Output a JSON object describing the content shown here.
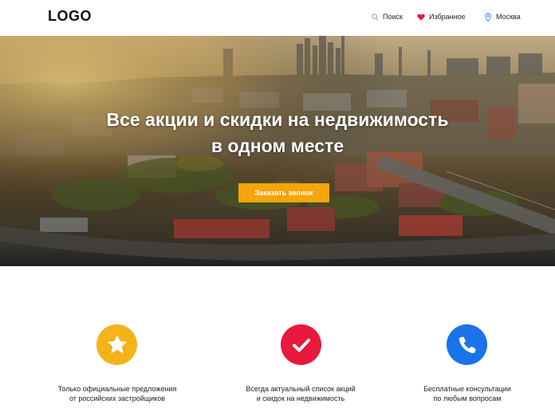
{
  "header": {
    "logo": "LOGO",
    "nav": {
      "search": {
        "label": "Поиск",
        "icon": "search-icon"
      },
      "favorites": {
        "label": "Избранное",
        "icon": "heart-icon"
      },
      "city": {
        "label": "Москва",
        "icon": "map-pin-icon"
      }
    }
  },
  "hero": {
    "title_line1": "Все акции и скидки на недвижимость",
    "title_line2": "в одном месте",
    "cta_label": "Заказать звонок"
  },
  "features": [
    {
      "icon": "star-icon",
      "color": "#f5b31a",
      "line1": "Только официальные предложения",
      "line2": "от российских застройщиков"
    },
    {
      "icon": "check-icon",
      "color": "#e8193c",
      "line1": "Всегда актуальный список акций",
      "line2": "и скидок на недвижимость"
    },
    {
      "icon": "phone-icon",
      "color": "#1a73e8",
      "line1": "Бесплатные консультации",
      "line2": "по любым вопросам"
    }
  ],
  "colors": {
    "accent": "#f5a50a",
    "heart": "#e8193c",
    "pin": "#4a90d9"
  }
}
